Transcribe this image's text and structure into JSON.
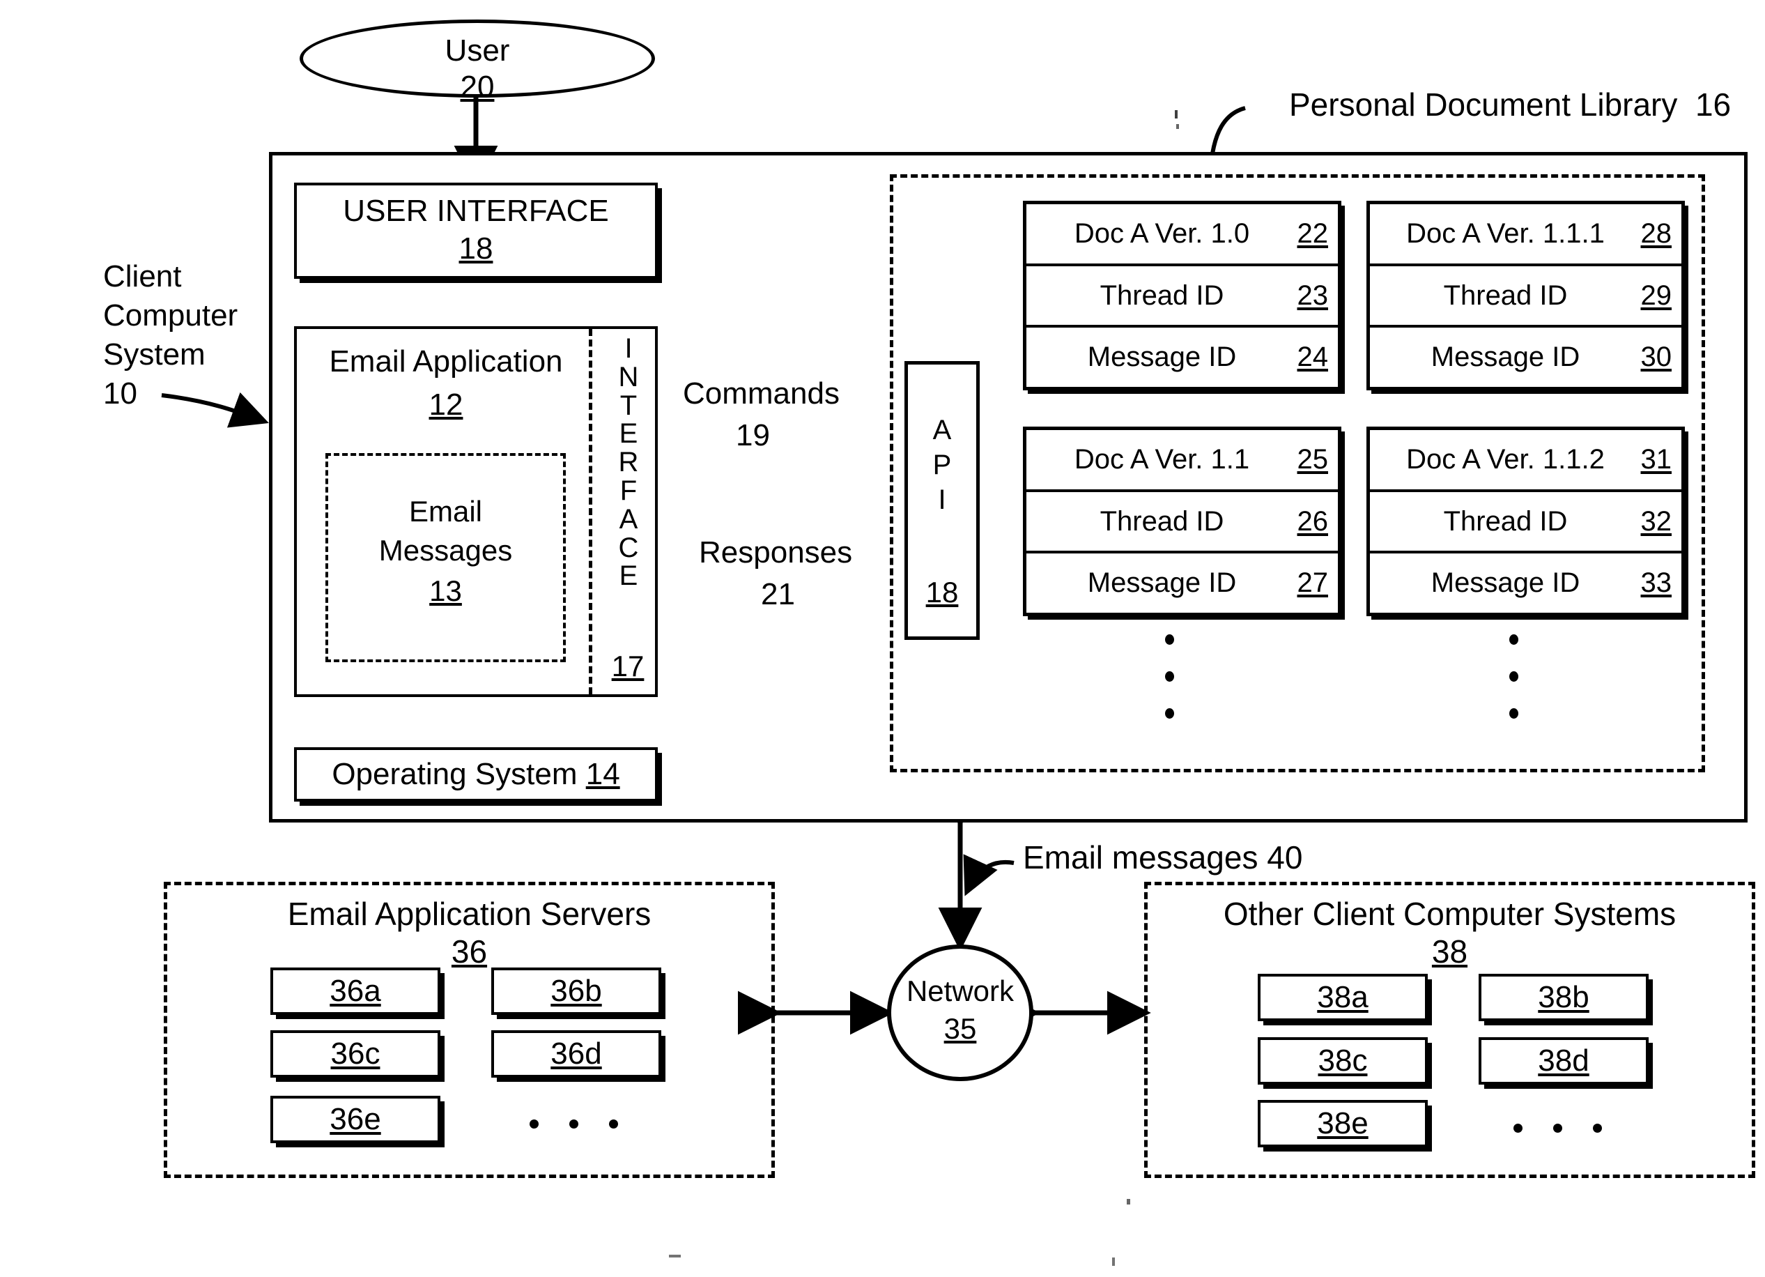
{
  "figure": {
    "user_node": {
      "label": "User",
      "ref": "20"
    },
    "client_system": {
      "label_line1": "Client",
      "label_line2": "Computer",
      "label_line3": "System",
      "ref": "10"
    },
    "user_interface": {
      "label": "USER INTERFACE",
      "ref": "18"
    },
    "email_application": {
      "label": "Email Application",
      "ref": "12"
    },
    "email_messages": {
      "label_line1": "Email",
      "label_line2": "Messages",
      "ref": "13"
    },
    "interface_column": {
      "letters": "INTERFACE",
      "ref": "17"
    },
    "operating_system": {
      "label": "Operating System",
      "ref": "14"
    },
    "commands_arrow": {
      "label": "Commands",
      "ref": "19"
    },
    "responses_arrow": {
      "label": "Responses",
      "ref": "21"
    },
    "api": {
      "letters": "API",
      "ref": "18"
    },
    "pdl": {
      "label": "Personal Document Library",
      "ref": "16"
    },
    "network": {
      "label": "Network",
      "ref": "35"
    },
    "email_messages_link": {
      "label": "Email messages 40"
    },
    "email_app_servers": {
      "label": "Email Application Servers",
      "ref": "36"
    },
    "other_clients": {
      "label": "Other Client Computer Systems",
      "ref": "38"
    }
  },
  "documents": [
    {
      "title": "Doc A Ver. 1.0",
      "title_ref": "22",
      "thread_label": "Thread ID",
      "thread_ref": "23",
      "message_label": "Message ID",
      "message_ref": "24"
    },
    {
      "title": "Doc A Ver. 1.1.1",
      "title_ref": "28",
      "thread_label": "Thread ID",
      "thread_ref": "29",
      "message_label": "Message ID",
      "message_ref": "30"
    },
    {
      "title": "Doc A Ver. 1.1",
      "title_ref": "25",
      "thread_label": "Thread ID",
      "thread_ref": "26",
      "message_label": "Message ID",
      "message_ref": "27"
    },
    {
      "title": "Doc A Ver. 1.1.2",
      "title_ref": "31",
      "thread_label": "Thread ID",
      "thread_ref": "32",
      "message_label": "Message ID",
      "message_ref": "33"
    }
  ],
  "servers": [
    {
      "label": "36a"
    },
    {
      "label": "36b"
    },
    {
      "label": "36c"
    },
    {
      "label": "36d"
    },
    {
      "label": "36e"
    }
  ],
  "clients": [
    {
      "label": "38a"
    },
    {
      "label": "38b"
    },
    {
      "label": "38c"
    },
    {
      "label": "38d"
    },
    {
      "label": "38e"
    }
  ],
  "colors": {
    "ink": "#000000",
    "paper": "#ffffff"
  }
}
